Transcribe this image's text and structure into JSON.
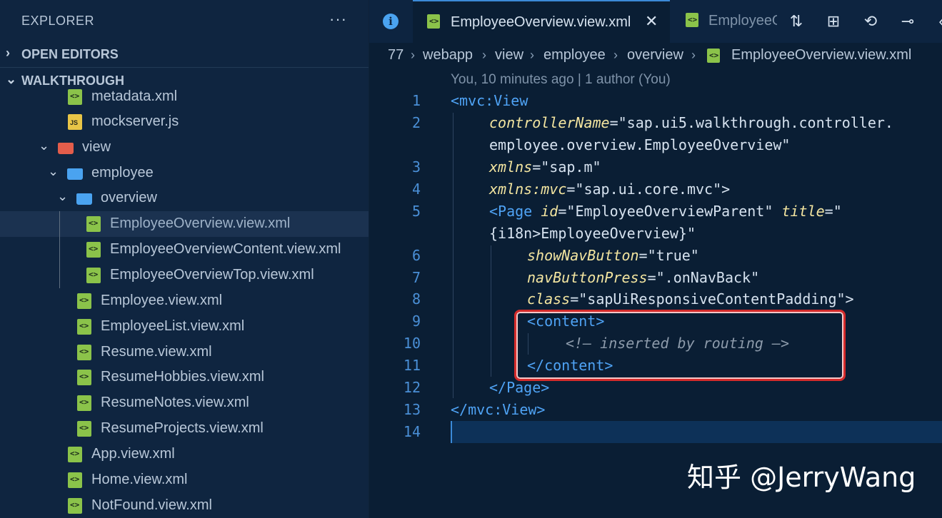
{
  "sidebar": {
    "title": "EXPLORER",
    "more_icon": "ellipsis-icon",
    "sections": {
      "open_editors": "OPEN EDITORS",
      "walkthrough": "WALKTHROUGH"
    },
    "tree": [
      {
        "label": "metadata.xml",
        "icon": "xml-file-icon"
      },
      {
        "label": "mockserver.js",
        "icon": "js-file-icon"
      },
      {
        "label": "view",
        "icon": "folder-icon"
      },
      {
        "label": "employee",
        "icon": "folder-icon"
      },
      {
        "label": "overview",
        "icon": "folder-icon"
      },
      {
        "label": "EmployeeOverview.view.xml",
        "icon": "xml-file-icon",
        "selected": true
      },
      {
        "label": "EmployeeOverviewContent.view.xml",
        "icon": "xml-file-icon"
      },
      {
        "label": "EmployeeOverviewTop.view.xml",
        "icon": "xml-file-icon"
      },
      {
        "label": "Employee.view.xml",
        "icon": "xml-file-icon"
      },
      {
        "label": "EmployeeList.view.xml",
        "icon": "xml-file-icon"
      },
      {
        "label": "Resume.view.xml",
        "icon": "xml-file-icon"
      },
      {
        "label": "ResumeHobbies.view.xml",
        "icon": "xml-file-icon"
      },
      {
        "label": "ResumeNotes.view.xml",
        "icon": "xml-file-icon"
      },
      {
        "label": "ResumeProjects.view.xml",
        "icon": "xml-file-icon"
      },
      {
        "label": "App.view.xml",
        "icon": "xml-file-icon"
      },
      {
        "label": "Home.view.xml",
        "icon": "xml-file-icon"
      },
      {
        "label": "NotFound.view.xml",
        "icon": "xml-file-icon"
      }
    ]
  },
  "tabs": {
    "active": "EmployeeOverview.view.xml",
    "inactive": "EmployeeO",
    "close_glyph": "✕"
  },
  "breadcrumb": [
    "77",
    "webapp",
    "view",
    "employee",
    "overview",
    "EmployeeOverview.view.xml"
  ],
  "blame": "You, 10 minutes ago | 1 author (You)",
  "code": {
    "line_numbers": [
      "1",
      "2",
      "3",
      "4",
      "5",
      "6",
      "7",
      "8",
      "9",
      "10",
      "11",
      "12",
      "13",
      "14"
    ],
    "l1_tag": "<mvc:View",
    "l2_attr": "controllerName",
    "l2_val": "\"sap.ui5.walkthrough.controller.",
    "l2_cont": "employee.overview.EmployeeOverview\"",
    "l3_attr": "xmlns",
    "l3_val": "\"sap.m\"",
    "l4_attr": "xmlns:mvc",
    "l4_val": "\"sap.ui.core.mvc\"",
    "l5_tag": "<Page",
    "l5_attr1": "id",
    "l5_val1": "\"EmployeeOverviewParent\"",
    "l5_attr2": "title",
    "l5_val2": "\"",
    "l5_cont": "{i18n>EmployeeOverview}\"",
    "l6_attr": "showNavButton",
    "l6_val": "\"true\"",
    "l7_attr": "navButtonPress",
    "l7_val": "\".onNavBack\"",
    "l8_attr": "class",
    "l8_val": "\"sapUiResponsiveContentPadding\"",
    "l9_tag": "<content>",
    "l10_comment": "<!— inserted by routing —>",
    "l11_tag": "</content>",
    "l12_tag": "</Page>",
    "l13_tag": "</mvc:View>"
  },
  "watermark": "知乎 @JerryWang",
  "colors": {
    "tag": "#4fa3f5",
    "attribute": "#f3e5a0",
    "string": "#d6e2ef",
    "comment": "#8d9bab",
    "highlight_box": "#d42a2a"
  }
}
